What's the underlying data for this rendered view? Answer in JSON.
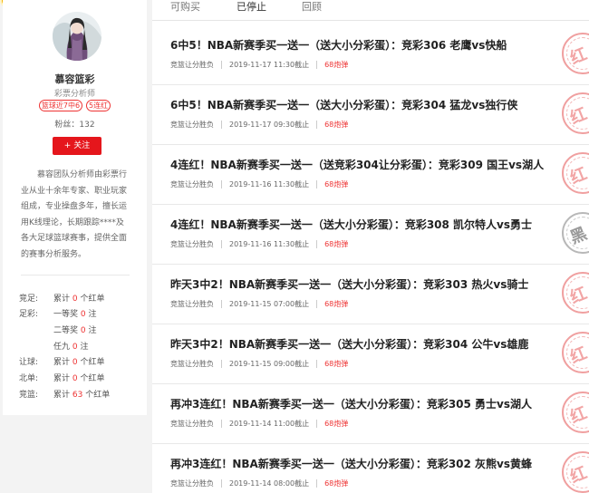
{
  "colors": {
    "accent": "#e5161c",
    "win": "#f2a5a5",
    "miss": "#9a9a9a"
  },
  "profile": {
    "name": "慕容篮彩",
    "role": "彩票分析师",
    "tags": [
      "篮球近7中6",
      "5连红"
    ],
    "fans": "粉丝：132",
    "follow_label": "+ 关注",
    "intro": "慕容团队分析师由彩票行业从业十余年专家、职业玩家组成，专业操盘多年，擅长运用K线理论，长期跟踪****及各大足球篮球赛事，提供全面的赛事分析服务。"
  },
  "stats": [
    {
      "label": "竞足:",
      "prefix": "累计 ",
      "num": "0",
      "suffix": " 个红单"
    },
    {
      "label": "足彩:",
      "prefix": "一等奖 ",
      "num": "0",
      "suffix": " 注"
    },
    {
      "label": "",
      "prefix": "二等奖 ",
      "num": "0",
      "suffix": " 注"
    },
    {
      "label": "",
      "prefix": "任九 ",
      "num": "0",
      "suffix": " 注"
    },
    {
      "label": "让球:",
      "prefix": "累计 ",
      "num": "0",
      "suffix": " 个红单"
    },
    {
      "label": "北单:",
      "prefix": "累计 ",
      "num": "0",
      "suffix": " 个红单"
    },
    {
      "label": "竞篮:",
      "prefix": "累计 ",
      "num": "63",
      "suffix": " 个红单"
    }
  ],
  "tabs": [
    "可购买",
    "已停止",
    "回顾"
  ],
  "articles": [
    {
      "title": "6中5！NBA新赛季买一送一（送大小分彩蛋）：竞彩306 老鹰vs快船",
      "category": "竞篮让分胜负",
      "time": "2019-11-17 11:30截止",
      "price": "68炮弹",
      "stamp": "红",
      "result": "win"
    },
    {
      "title": "6中5！NBA新赛季买一送一（送大小分彩蛋）：竞彩304 猛龙vs独行侠",
      "category": "竞篮让分胜负",
      "time": "2019-11-17 09:30截止",
      "price": "68炮弹",
      "stamp": "红",
      "result": "win"
    },
    {
      "title": "4连红！NBA新赛季买一送一（送竞彩304让分彩蛋）：竞彩309 国王vs湖人",
      "category": "竞篮让分胜负",
      "time": "2019-11-16 11:30截止",
      "price": "68炮弹",
      "stamp": "红",
      "result": "win"
    },
    {
      "title": "4连红！NBA新赛季买一送一（送大小分彩蛋）：竞彩308 凯尔特人vs勇士",
      "category": "竞篮让分胜负",
      "time": "2019-11-16 11:30截止",
      "price": "68炮弹",
      "stamp": "黑",
      "result": "miss"
    },
    {
      "title": "昨天3中2！NBA新赛季买一送一（送大小分彩蛋）：竞彩303 热火vs骑士",
      "category": "竞篮让分胜负",
      "time": "2019-11-15 07:00截止",
      "price": "68炮弹",
      "stamp": "红",
      "result": "win"
    },
    {
      "title": "昨天3中2！NBA新赛季买一送一（送大小分彩蛋）：竞彩304 公牛vs雄鹿",
      "category": "竞篮让分胜负",
      "time": "2019-11-15 09:00截止",
      "price": "68炮弹",
      "stamp": "红",
      "result": "win"
    },
    {
      "title": "再冲3连红！NBA新赛季买一送一（送大小分彩蛋）：竞彩305 勇士vs湖人",
      "category": "竞篮让分胜负",
      "time": "2019-11-14 11:00截止",
      "price": "68炮弹",
      "stamp": "红",
      "result": "win"
    },
    {
      "title": "再冲3连红！NBA新赛季买一送一（送大小分彩蛋）：竞彩302 灰熊vs黄蜂",
      "category": "竞篮让分胜负",
      "time": "2019-11-14 08:00截止",
      "price": "68炮弹",
      "stamp": "红",
      "result": "win"
    }
  ]
}
